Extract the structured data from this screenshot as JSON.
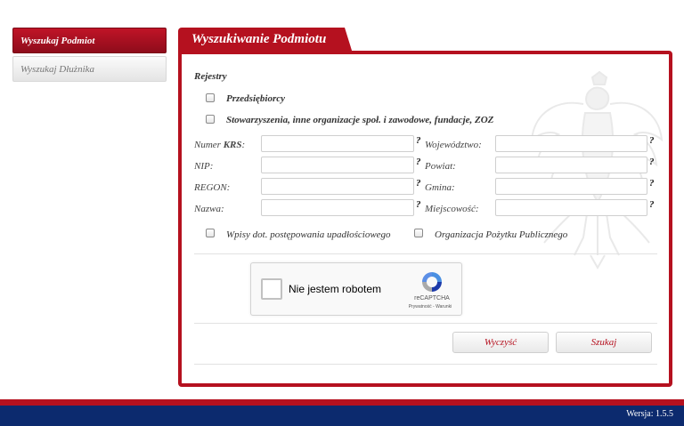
{
  "sidebar": {
    "items": [
      {
        "label": "Wyszukaj Podmiot"
      },
      {
        "label": "Wyszukaj Dłużnika"
      }
    ]
  },
  "panel": {
    "title": "Wyszukiwanie Podmiotu",
    "registries_label": "Rejestry",
    "registries": [
      {
        "label": "Przedsiębiorcy",
        "checked": false
      },
      {
        "label": "Stowarzyszenia, inne organizacje społ. i zawodowe, fundacje, ZOZ",
        "checked": false
      }
    ],
    "fields_left": [
      {
        "label_prefix": "Numer ",
        "label_bold": "KRS",
        "label_suffix": ":",
        "value": ""
      },
      {
        "label_prefix": "NIP:",
        "label_bold": "",
        "label_suffix": "",
        "value": ""
      },
      {
        "label_prefix": "REGON:",
        "label_bold": "",
        "label_suffix": "",
        "value": ""
      },
      {
        "label_prefix": "Nazwa:",
        "label_bold": "",
        "label_suffix": "",
        "value": ""
      }
    ],
    "fields_right": [
      {
        "label": "Województwo:",
        "value": ""
      },
      {
        "label": "Powiat:",
        "value": ""
      },
      {
        "label": "Gmina:",
        "value": ""
      },
      {
        "label": "Miejscowość:",
        "value": ""
      }
    ],
    "help_mark": "?",
    "options": [
      {
        "label": "Wpisy dot. postępowania upadłościowego",
        "checked": false
      },
      {
        "label": "Organizacja Pożytku Publicznego",
        "checked": false
      }
    ],
    "captcha": {
      "label": "Nie jestem robotem",
      "brand": "reCAPTCHA",
      "links": "Prywatność - Warunki"
    },
    "buttons": {
      "clear": "Wyczyść",
      "search": "Szukaj"
    }
  },
  "footer": {
    "version": "Wersja: 1.5.5"
  },
  "colors": {
    "accent_red": "#b5111f",
    "footer_blue": "#0c2a6e"
  }
}
